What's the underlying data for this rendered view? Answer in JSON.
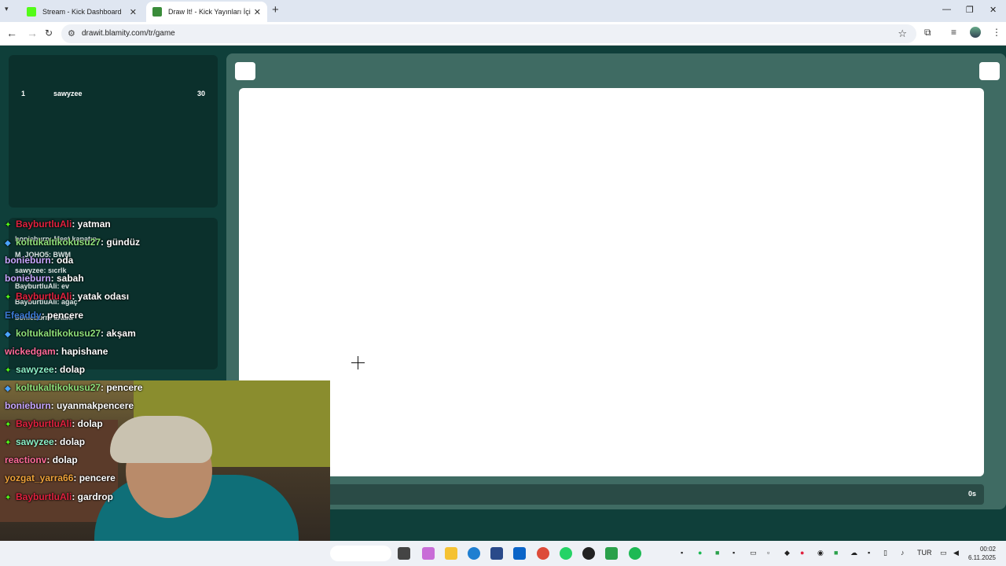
{
  "browser": {
    "tabs": [
      {
        "title": "Stream - Kick Dashboard",
        "active": false
      },
      {
        "title": "Draw It! - Kick Yayınları İçin Çiz",
        "active": true
      }
    ],
    "url": "drawit.blamity.com/tr/game"
  },
  "leaderboard": {
    "rank": "1",
    "name": "sawyzee",
    "score": "30"
  },
  "inner_chat": [
    "bonieburn: Meet kapatın",
    "M_JOHO5: BWM",
    "sawyzee: sıcrlk",
    "BayburtluAli: ev",
    "BayburtluAli: ağaç",
    "bonieburn: araba"
  ],
  "game": {
    "timer": "0s"
  },
  "chat_overlay": [
    {
      "user": "BayburtluAli",
      "msg": ": yatman",
      "color": "red",
      "badge": "✦"
    },
    {
      "user": "koltukaltikokusu27",
      "msg": ": gündüz",
      "color": "green",
      "badge": "◆"
    },
    {
      "user": "bonieburn",
      "msg": ": oda",
      "color": "purple",
      "badge": ""
    },
    {
      "user": "bonieburn",
      "msg": ": sabah",
      "color": "purple",
      "badge": ""
    },
    {
      "user": "BayburtluAli",
      "msg": ": yatak odası",
      "color": "red",
      "badge": "✦"
    },
    {
      "user": "Efeaddy",
      "msg": ": pencere",
      "color": "blue",
      "badge": ""
    },
    {
      "user": "koltukaltikokusu27",
      "msg": ": akşam",
      "color": "green",
      "badge": "◆"
    },
    {
      "user": "wickedgam",
      "msg": ": hapishane",
      "color": "pink",
      "badge": ""
    },
    {
      "user": "sawyzee",
      "msg": ": dolap",
      "color": "mint",
      "badge": "✦"
    },
    {
      "user": "koltukaltikokusu27",
      "msg": ": pencere",
      "color": "green",
      "badge": "◆"
    },
    {
      "user": "bonieburn",
      "msg": ": uyanmakpencere",
      "color": "purple",
      "badge": ""
    },
    {
      "user": "BayburtluAli",
      "msg": ": dolap",
      "color": "red",
      "badge": "✦"
    },
    {
      "user": "sawyzee",
      "msg": ": dolap",
      "color": "mint",
      "badge": "✦"
    },
    {
      "user": "reactionv",
      "msg": ": dolap",
      "color": "pink",
      "badge": ""
    },
    {
      "user": "yozgat_yarra66",
      "msg": ": pencere",
      "color": "orange",
      "badge": ""
    },
    {
      "user": "BayburtluAli",
      "msg": ": gardrop",
      "color": "red",
      "badge": "✦"
    }
  ],
  "taskbar": {
    "lang": "TUR",
    "time": "00:02",
    "date": "6.11.2025"
  },
  "colors": {
    "page_bg": "#0f3f3a",
    "panel_bg": "#3f6b63",
    "kick_green": "#53fc18"
  }
}
